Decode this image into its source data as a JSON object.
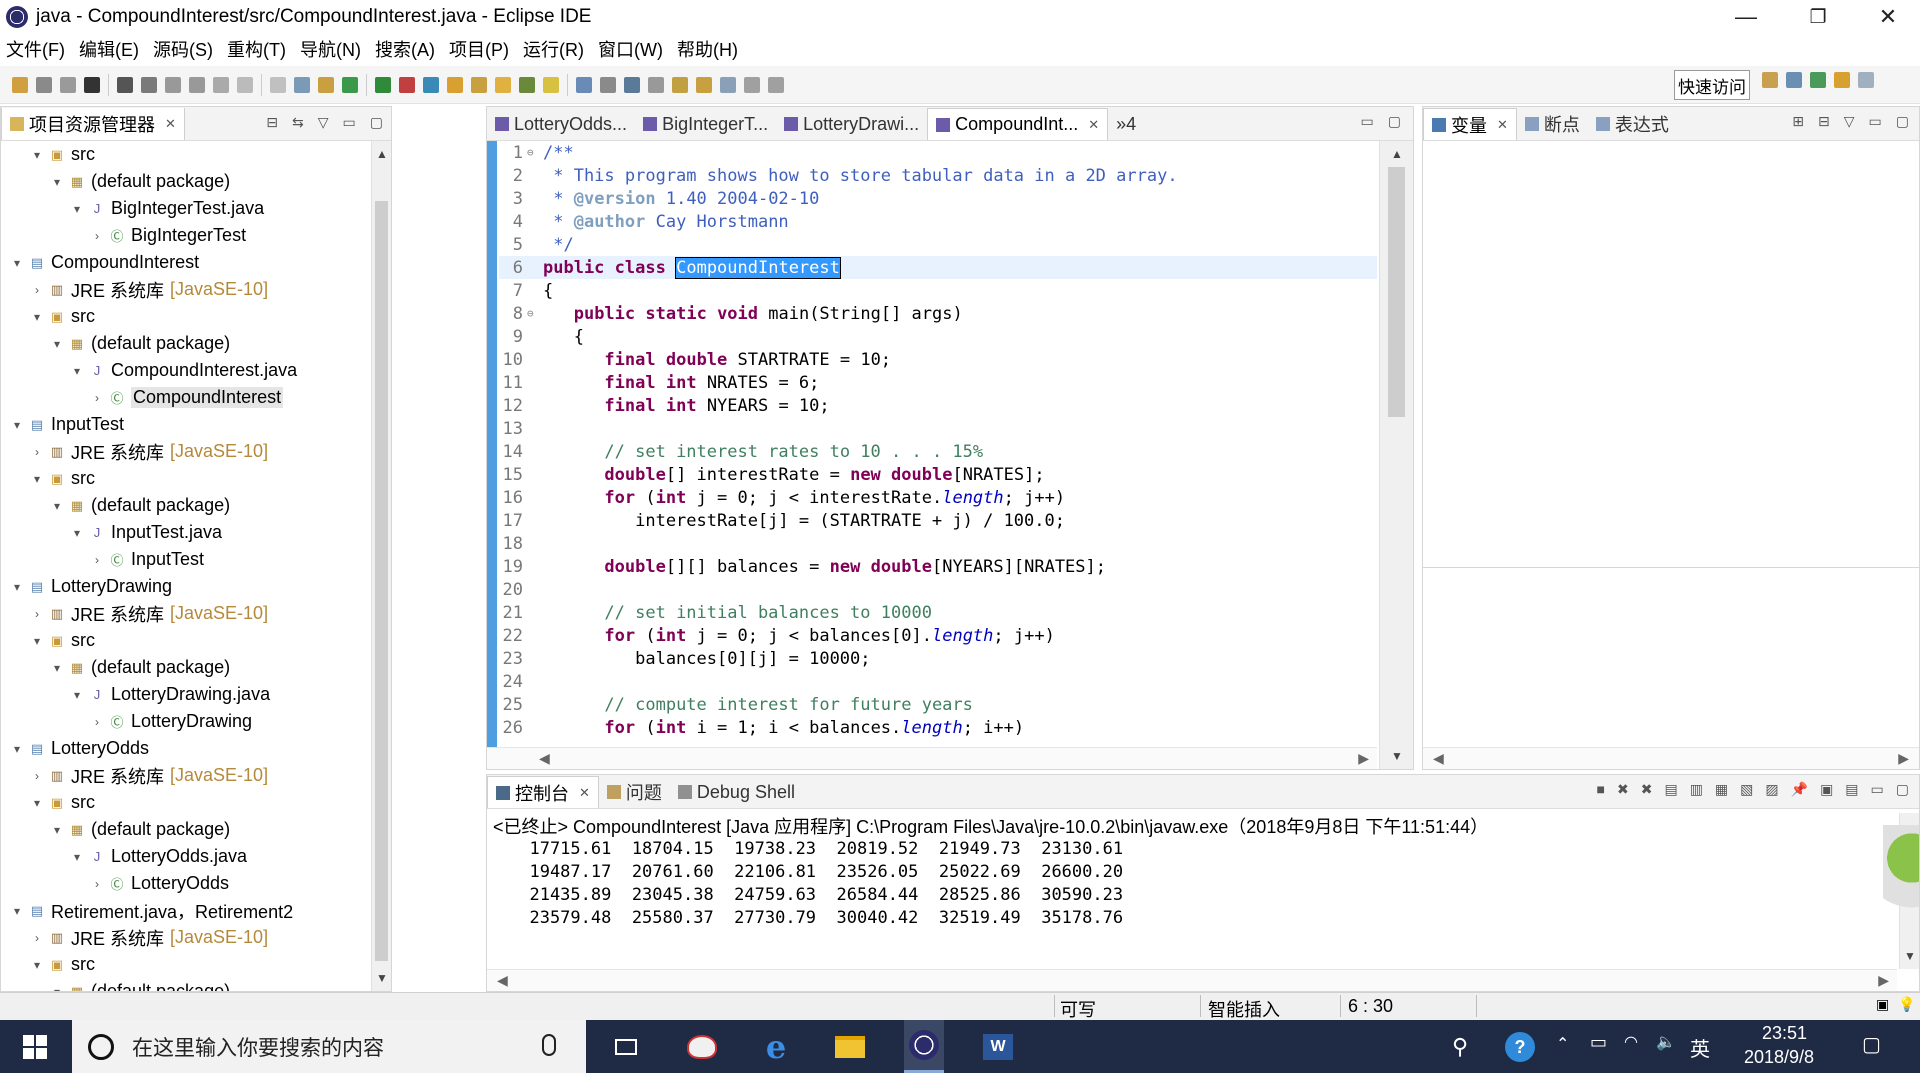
{
  "window": {
    "title": "java - CompoundInterest/src/CompoundInterest.java - Eclipse IDE",
    "minimize": "—",
    "maximize": "❐",
    "close": "✕"
  },
  "menu": [
    "文件(F)",
    "编辑(E)",
    "源码(S)",
    "重构(T)",
    "导航(N)",
    "搜索(A)",
    "项目(P)",
    "运行(R)",
    "窗口(W)",
    "帮助(H)"
  ],
  "toolbar": {
    "quick_access": "快速访问"
  },
  "package_explorer": {
    "tab_label": "项目资源管理器",
    "tree": [
      {
        "depth": 1,
        "twisty": "open",
        "icon": "src-folder-icon",
        "label": "src"
      },
      {
        "depth": 2,
        "twisty": "open",
        "icon": "package-icon",
        "label": "(default package)"
      },
      {
        "depth": 3,
        "twisty": "open",
        "icon": "java-file-icon",
        "label": "BigIntegerTest.java"
      },
      {
        "depth": 4,
        "twisty": "closed",
        "icon": "class-icon",
        "label": "BigIntegerTest"
      },
      {
        "depth": 0,
        "twisty": "open",
        "icon": "project-icon",
        "label": "CompoundInterest"
      },
      {
        "depth": 1,
        "twisty": "closed",
        "icon": "jre-library-icon",
        "label": "JRE 系统库",
        "suffix": "[JavaSE-10]"
      },
      {
        "depth": 1,
        "twisty": "open",
        "icon": "src-folder-icon",
        "label": "src"
      },
      {
        "depth": 2,
        "twisty": "open",
        "icon": "package-icon",
        "label": "(default package)"
      },
      {
        "depth": 3,
        "twisty": "open",
        "icon": "java-file-icon",
        "label": "CompoundInterest.java"
      },
      {
        "depth": 4,
        "twisty": "closed",
        "icon": "class-icon",
        "label": "CompoundInterest",
        "selected": true
      },
      {
        "depth": 0,
        "twisty": "open",
        "icon": "project-icon",
        "label": "InputTest"
      },
      {
        "depth": 1,
        "twisty": "closed",
        "icon": "jre-library-icon",
        "label": "JRE 系统库",
        "suffix": "[JavaSE-10]"
      },
      {
        "depth": 1,
        "twisty": "open",
        "icon": "src-folder-icon",
        "label": "src"
      },
      {
        "depth": 2,
        "twisty": "open",
        "icon": "package-icon",
        "label": "(default package)"
      },
      {
        "depth": 3,
        "twisty": "open",
        "icon": "java-file-icon",
        "label": "InputTest.java"
      },
      {
        "depth": 4,
        "twisty": "closed",
        "icon": "class-icon",
        "label": "InputTest"
      },
      {
        "depth": 0,
        "twisty": "open",
        "icon": "project-icon",
        "label": "LotteryDrawing"
      },
      {
        "depth": 1,
        "twisty": "closed",
        "icon": "jre-library-icon",
        "label": "JRE 系统库",
        "suffix": "[JavaSE-10]"
      },
      {
        "depth": 1,
        "twisty": "open",
        "icon": "src-folder-icon",
        "label": "src"
      },
      {
        "depth": 2,
        "twisty": "open",
        "icon": "package-icon",
        "label": "(default package)"
      },
      {
        "depth": 3,
        "twisty": "open",
        "icon": "java-file-icon",
        "label": "LotteryDrawing.java"
      },
      {
        "depth": 4,
        "twisty": "closed",
        "icon": "class-icon",
        "label": "LotteryDrawing"
      },
      {
        "depth": 0,
        "twisty": "open",
        "icon": "project-icon",
        "label": "LotteryOdds"
      },
      {
        "depth": 1,
        "twisty": "closed",
        "icon": "jre-library-icon",
        "label": "JRE 系统库",
        "suffix": "[JavaSE-10]"
      },
      {
        "depth": 1,
        "twisty": "open",
        "icon": "src-folder-icon",
        "label": "src"
      },
      {
        "depth": 2,
        "twisty": "open",
        "icon": "package-icon",
        "label": "(default package)"
      },
      {
        "depth": 3,
        "twisty": "open",
        "icon": "java-file-icon",
        "label": "LotteryOdds.java"
      },
      {
        "depth": 4,
        "twisty": "closed",
        "icon": "class-icon",
        "label": "LotteryOdds"
      },
      {
        "depth": 0,
        "twisty": "open",
        "icon": "project-icon",
        "label": "Retirement.java，Retirement2"
      },
      {
        "depth": 1,
        "twisty": "closed",
        "icon": "jre-library-icon",
        "label": "JRE 系统库",
        "suffix": "[JavaSE-10]"
      },
      {
        "depth": 1,
        "twisty": "open",
        "icon": "src-folder-icon",
        "label": "src"
      },
      {
        "depth": 2,
        "twisty": "open",
        "icon": "package-icon",
        "label": "(default package)"
      }
    ]
  },
  "editor": {
    "tabs": [
      {
        "label": "LotteryOdds...",
        "active": false
      },
      {
        "label": "BigIntegerT...",
        "active": false
      },
      {
        "label": "LotteryDrawi...",
        "active": false
      },
      {
        "label": "CompoundInt...",
        "active": true
      }
    ],
    "overflow_label": "»4",
    "lines": [
      {
        "n": "1",
        "fold": "⊖",
        "parts": [
          [
            "jd",
            "/**"
          ]
        ]
      },
      {
        "n": "2",
        "parts": [
          [
            "jd",
            " * This program shows how to store tabular data in a 2D array."
          ]
        ]
      },
      {
        "n": "3",
        "parts": [
          [
            "jd",
            " * "
          ],
          [
            "jtag",
            "@version"
          ],
          [
            "jd",
            " 1.40 2004-02-10"
          ]
        ]
      },
      {
        "n": "4",
        "parts": [
          [
            "jd",
            " * "
          ],
          [
            "jtag",
            "@author"
          ],
          [
            "jd",
            " Cay Horstmann"
          ]
        ]
      },
      {
        "n": "5",
        "parts": [
          [
            "jd",
            " */"
          ]
        ]
      },
      {
        "n": "6",
        "current": true,
        "parts": [
          [
            "kw",
            "public"
          ],
          [
            "",
            " "
          ],
          [
            "kw",
            "class"
          ],
          [
            "",
            " "
          ],
          [
            "hl",
            "CompoundInterest"
          ]
        ]
      },
      {
        "n": "7",
        "parts": [
          [
            "",
            "{"
          ]
        ]
      },
      {
        "n": "8",
        "fold": "⊖",
        "parts": [
          [
            "",
            "   "
          ],
          [
            "kw",
            "public"
          ],
          [
            "",
            " "
          ],
          [
            "kw",
            "static"
          ],
          [
            "",
            " "
          ],
          [
            "kw",
            "void"
          ],
          [
            "",
            " main(String[] args)"
          ]
        ]
      },
      {
        "n": "9",
        "parts": [
          [
            "",
            "   {"
          ]
        ]
      },
      {
        "n": "10",
        "parts": [
          [
            "",
            "      "
          ],
          [
            "kw",
            "final"
          ],
          [
            "",
            " "
          ],
          [
            "kw",
            "double"
          ],
          [
            "",
            " STARTRATE = 10;"
          ]
        ]
      },
      {
        "n": "11",
        "parts": [
          [
            "",
            "      "
          ],
          [
            "kw",
            "final"
          ],
          [
            "",
            " "
          ],
          [
            "kw",
            "int"
          ],
          [
            "",
            " NRATES = 6;"
          ]
        ]
      },
      {
        "n": "12",
        "parts": [
          [
            "",
            "      "
          ],
          [
            "kw",
            "final"
          ],
          [
            "",
            " "
          ],
          [
            "kw",
            "int"
          ],
          [
            "",
            " NYEARS = 10;"
          ]
        ]
      },
      {
        "n": "13",
        "parts": [
          [
            "",
            ""
          ]
        ]
      },
      {
        "n": "14",
        "parts": [
          [
            "",
            "      "
          ],
          [
            "cm",
            "// set interest rates to 10 . . . 15%"
          ]
        ]
      },
      {
        "n": "15",
        "parts": [
          [
            "",
            "      "
          ],
          [
            "kw",
            "double"
          ],
          [
            "",
            "[] interestRate = "
          ],
          [
            "kw",
            "new"
          ],
          [
            "",
            " "
          ],
          [
            "kw",
            "double"
          ],
          [
            "",
            "[NRATES];"
          ]
        ]
      },
      {
        "n": "16",
        "parts": [
          [
            "",
            "      "
          ],
          [
            "kw",
            "for"
          ],
          [
            "",
            " ("
          ],
          [
            "kw",
            "int"
          ],
          [
            "",
            " j = 0; j < interestRate."
          ],
          [
            "fld",
            "length"
          ],
          [
            "",
            "; j++)"
          ]
        ]
      },
      {
        "n": "17",
        "parts": [
          [
            "",
            "         interestRate[j] = (STARTRATE + j) / 100.0;"
          ]
        ]
      },
      {
        "n": "18",
        "parts": [
          [
            "",
            ""
          ]
        ]
      },
      {
        "n": "19",
        "parts": [
          [
            "",
            "      "
          ],
          [
            "kw",
            "double"
          ],
          [
            "",
            "[][] balances = "
          ],
          [
            "kw",
            "new"
          ],
          [
            "",
            " "
          ],
          [
            "kw",
            "double"
          ],
          [
            "",
            "[NYEARS][NRATES];"
          ]
        ]
      },
      {
        "n": "20",
        "parts": [
          [
            "",
            ""
          ]
        ]
      },
      {
        "n": "21",
        "parts": [
          [
            "",
            "      "
          ],
          [
            "cm",
            "// set initial balances to 10000"
          ]
        ]
      },
      {
        "n": "22",
        "parts": [
          [
            "",
            "      "
          ],
          [
            "kw",
            "for"
          ],
          [
            "",
            " ("
          ],
          [
            "kw",
            "int"
          ],
          [
            "",
            " j = 0; j < balances[0]."
          ],
          [
            "fld",
            "length"
          ],
          [
            "",
            "; j++)"
          ]
        ]
      },
      {
        "n": "23",
        "parts": [
          [
            "",
            "         balances[0][j] = 10000;"
          ]
        ]
      },
      {
        "n": "24",
        "parts": [
          [
            "",
            ""
          ]
        ]
      },
      {
        "n": "25",
        "parts": [
          [
            "",
            "      "
          ],
          [
            "cm",
            "// compute interest for future years"
          ]
        ]
      },
      {
        "n": "26",
        "parts": [
          [
            "",
            "      "
          ],
          [
            "kw",
            "for"
          ],
          [
            "",
            " ("
          ],
          [
            "kw",
            "int"
          ],
          [
            "",
            " i = 1; i < balances."
          ],
          [
            "fld",
            "length"
          ],
          [
            "",
            "; i++)"
          ]
        ]
      }
    ]
  },
  "debug_views": {
    "tabs": [
      {
        "label": "变量",
        "active": true
      },
      {
        "label": "断点",
        "active": false
      },
      {
        "label": "表达式",
        "active": false
      }
    ]
  },
  "console": {
    "tabs": [
      {
        "label": "控制台",
        "active": true
      },
      {
        "label": "问题",
        "active": false
      },
      {
        "label": "Debug Shell",
        "active": false
      }
    ],
    "header": "<已终止> CompoundInterest [Java 应用程序] C:\\Program Files\\Java\\jre-10.0.2\\bin\\javaw.exe（2018年9月8日 下午11:51:44）",
    "rows": [
      "  17715.61  18704.15  19738.23  20819.52  21949.73  23130.61",
      "  19487.17  20761.60  22106.81  23526.05  25022.69  26600.20",
      "  21435.89  23045.38  24759.63  26584.44  28525.86  30590.23",
      "  23579.48  25580.37  27730.79  30040.42  32519.49  35178.76"
    ]
  },
  "status": {
    "writable": "可写",
    "insert_mode": "智能插入",
    "position": "6 : 30"
  },
  "taskbar": {
    "search_placeholder": "在这里输入你要搜索的内容",
    "ime": "英",
    "time": "23:51",
    "date": "2018/9/8"
  }
}
